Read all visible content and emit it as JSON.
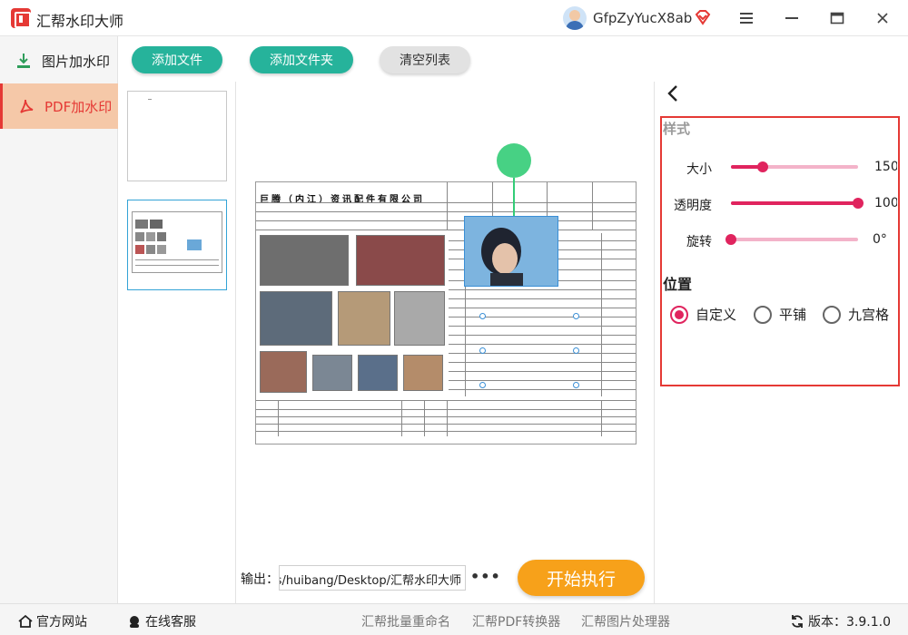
{
  "app": {
    "title": "汇帮水印大师",
    "username": "GfpZyYucX8ab"
  },
  "colors": {
    "accent": "#e0245e",
    "primary_button": "#26b39b",
    "start_button": "#f7a11a",
    "active_nav_bg": "#f5c8a8",
    "highlight_border": "#e53935"
  },
  "nav": {
    "items": [
      {
        "label": "图片加水印",
        "icon": "download-image-icon"
      },
      {
        "label": "PDF加水印",
        "icon": "pdf-icon"
      }
    ]
  },
  "toolbar": {
    "add_file": "添加文件",
    "add_folder": "添加文件夹",
    "clear_list": "清空列表"
  },
  "document": {
    "company_title": "巨腾（内江）资讯配件有限公司"
  },
  "output": {
    "label": "输出：",
    "path": "C:/Users/huibang/Desktop/汇帮水印大师",
    "more": "•••",
    "start": "开始执行"
  },
  "settings": {
    "style_title": "样式",
    "size": {
      "label": "大小",
      "value": "150",
      "percent": 0.25
    },
    "opacity": {
      "label": "透明度",
      "value": "100 %",
      "percent": 1.0
    },
    "rotate": {
      "label": "旋转",
      "value": "0°",
      "percent": 0.0
    },
    "position_title": "位置",
    "position_options": [
      {
        "label": "自定义",
        "checked": true
      },
      {
        "label": "平铺",
        "checked": false
      },
      {
        "label": "九宫格",
        "checked": false
      }
    ]
  },
  "footer": {
    "website": "官方网站",
    "support": "在线客服",
    "rename": "汇帮批量重命名",
    "pdf_converter": "汇帮PDF转换器",
    "image_processor": "汇帮图片处理器",
    "version": "版本：3.9.1.0"
  }
}
